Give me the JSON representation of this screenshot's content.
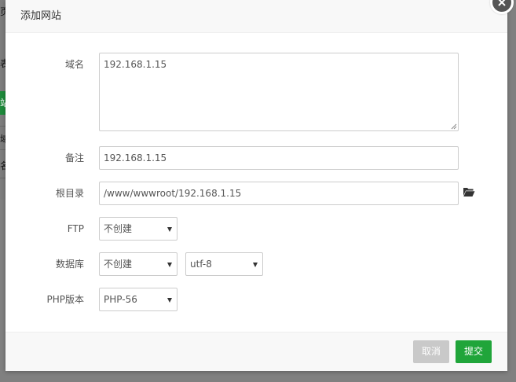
{
  "background": {
    "chars": [
      "页",
      "表",
      "站",
      "域",
      "名"
    ]
  },
  "modal": {
    "title": "添加网站",
    "close_icon": "close-icon"
  },
  "form": {
    "domain": {
      "label": "域名",
      "value": "192.168.1.15"
    },
    "remark": {
      "label": "备注",
      "value": "192.168.1.15"
    },
    "root": {
      "label": "根目录",
      "value": "/www/wwwroot/192.168.1.15",
      "icon": "folder-open-icon"
    },
    "ftp": {
      "label": "FTP",
      "selected": "不创建"
    },
    "database": {
      "label": "数据库",
      "selected": "不创建",
      "charset": "utf-8"
    },
    "php": {
      "label": "PHP版本",
      "selected": "PHP-56"
    }
  },
  "footer": {
    "cancel_label": "取消",
    "submit_label": "提交"
  },
  "colors": {
    "primary": "#20a53a",
    "disabled": "#c9c9c9",
    "overlay": "#808080"
  }
}
